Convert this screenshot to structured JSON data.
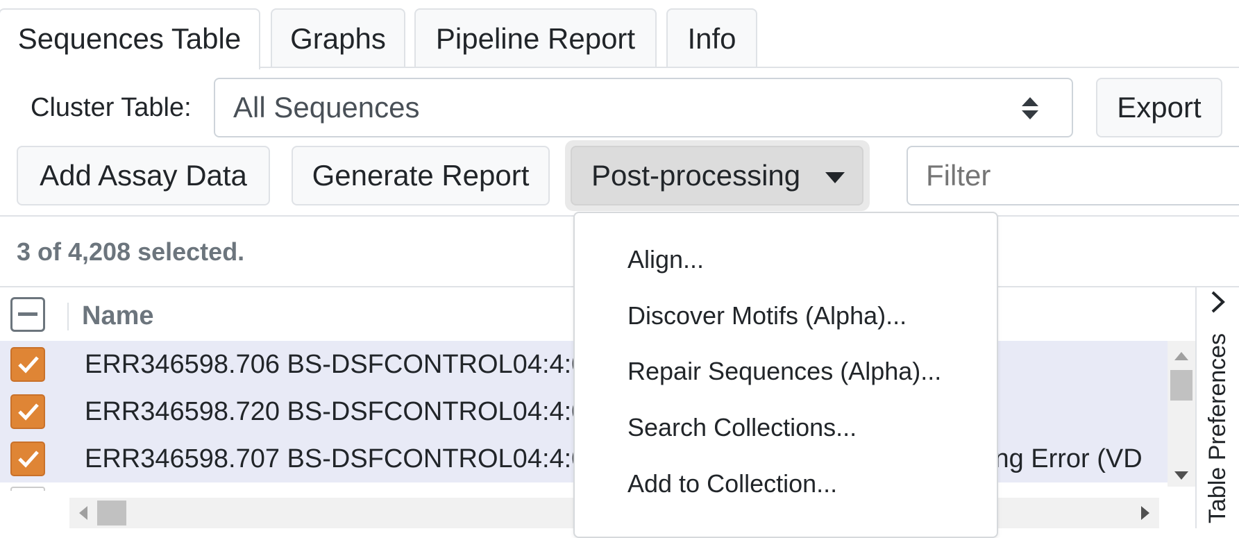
{
  "tabs": [
    {
      "label": "Sequences Table",
      "active": true
    },
    {
      "label": "Graphs"
    },
    {
      "label": "Pipeline Report"
    },
    {
      "label": "Info"
    }
  ],
  "cluster": {
    "label": "Cluster Table:",
    "selected": "All Sequences"
  },
  "export_label": "Export",
  "toolbar": {
    "add_assay": "Add Assay Data",
    "generate_report": "Generate Report",
    "post_processing": "Post-processing"
  },
  "filter": {
    "placeholder": "Filter"
  },
  "selection_status": "3 of 4,208 selected.",
  "table": {
    "header_name": "Name",
    "rows": [
      {
        "name": "ERR346598.706 BS-DSFCONTROL04:4:00"
      },
      {
        "name": "ERR346598.720 BS-DSFCONTROL04:4:00"
      },
      {
        "name": "ERR346598.707 BS-DSFCONTROL04:4:00",
        "trailing": "cing Error (VD"
      }
    ]
  },
  "menu": {
    "items": [
      "Align...",
      "Discover Motifs (Alpha)...",
      "Repair Sequences (Alpha)...",
      "Search Collections...",
      "Add to Collection..."
    ]
  },
  "side_panel_label": "Table Preferences",
  "colors": {
    "accent": "#df8535",
    "row_selected": "#e8eaf6",
    "border": "#dfe2e6",
    "button_bg": "#f8f9fa",
    "active_button_bg": "#dcdcdc"
  }
}
